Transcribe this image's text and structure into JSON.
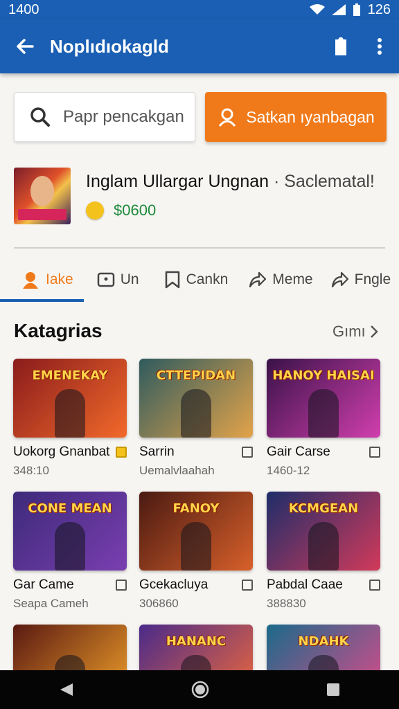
{
  "status": {
    "time": "1400",
    "right_time": "126"
  },
  "appbar": {
    "title": "Noplıdıokagld"
  },
  "search": {
    "placeholder": "Papr pencakgan",
    "button_label": "Satkan ıyanbagan"
  },
  "profile": {
    "name": "Inglam Ullargar Ungnan",
    "sub": "· Saclematal!",
    "price": "$0600"
  },
  "tabs": [
    {
      "label": "Iake",
      "active": true
    },
    {
      "label": "Un"
    },
    {
      "label": "Cankn"
    },
    {
      "label": "Meme"
    },
    {
      "label": "Fngle"
    }
  ],
  "section": {
    "title": "Katagrias",
    "see_all": "Gımı"
  },
  "cards": [
    {
      "title": "Uokorg Gnanbat",
      "sub": "348:10",
      "art": "EMENEKAY",
      "colors": [
        "#8a1c1c",
        "#f2692a"
      ]
    },
    {
      "title": "Sarrin",
      "sub": "Uemalvlaahah",
      "art": "CTTEPIDAN",
      "colors": [
        "#2f5b5e",
        "#e2a34a"
      ]
    },
    {
      "title": "Gair Carse",
      "sub": "1460-12",
      "art": "HANOY HAISAI",
      "colors": [
        "#3a1248",
        "#d13fae"
      ]
    },
    {
      "title": "Gar Came",
      "sub": "Seapa Cameh",
      "art": "CONE MEAN",
      "colors": [
        "#3d2a7a",
        "#7a3fb0"
      ]
    },
    {
      "title": "Gcekacluya",
      "sub": "306860",
      "art": "FANOY",
      "colors": [
        "#4a1a12",
        "#d8602a"
      ]
    },
    {
      "title": "Pabdal Caae",
      "sub": "388830",
      "art": "KCMGEAN",
      "colors": [
        "#1e2d6a",
        "#d23a5a"
      ]
    },
    {
      "title": "",
      "sub": "",
      "art": "",
      "colors": [
        "#5a1a12",
        "#f0a02a"
      ]
    },
    {
      "title": "",
      "sub": "",
      "art": "HANANC",
      "colors": [
        "#4a2a8a",
        "#f06a3a"
      ]
    },
    {
      "title": "",
      "sub": "",
      "art": "NDAHK",
      "colors": [
        "#1a6a8a",
        "#e04a8a"
      ]
    }
  ]
}
